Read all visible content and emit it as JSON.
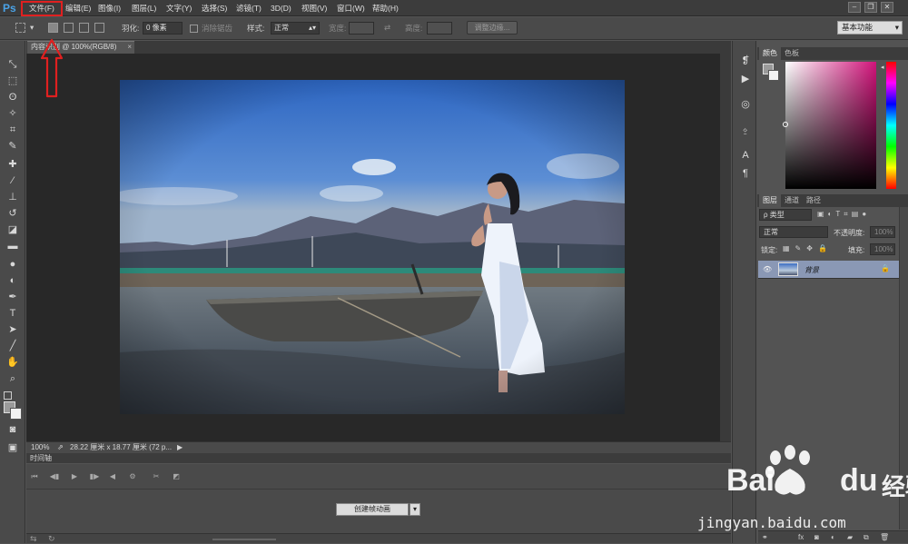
{
  "app": {
    "logo": "Ps"
  },
  "menu": {
    "items": [
      "文件(F)",
      "编辑(E)",
      "图像(I)",
      "图层(L)",
      "文字(Y)",
      "选择(S)",
      "滤镜(T)",
      "3D(D)",
      "视图(V)",
      "窗口(W)",
      "帮助(H)"
    ],
    "highlighted": "文件(F)"
  },
  "window_controls": {
    "minimize": "–",
    "restore": "❐",
    "close": "✕"
  },
  "options_bar": {
    "feather_label": "羽化:",
    "feather_value": "0 像素",
    "antialias_label": "消除锯齿",
    "style_label": "样式:",
    "style_value": "正常",
    "width_label": "宽度:",
    "height_label": "高度:",
    "refine_edge_button": "调整边缘...",
    "workspace": "基本功能"
  },
  "document": {
    "tab_title": "内容识别 @ 100%(RGB/8)",
    "tab_close": "×",
    "zoom": "100%",
    "doc_info": "28.22 厘米 x 18.77 厘米 (72 p..."
  },
  "timeline": {
    "tab_label": "时间轴",
    "create_button": "创建帧动画",
    "create_arrow": "▾"
  },
  "color_panel": {
    "tabs": [
      "颜色",
      "色板"
    ],
    "hue_color": "#d1137a"
  },
  "layers_panel": {
    "tabs": [
      "图层",
      "通道",
      "路径"
    ],
    "filter_type": "ρ 类型",
    "blend_mode": "正常",
    "opacity_label": "不透明度:",
    "opacity_value": "100%",
    "lock_label": "锁定:",
    "fill_label": "填充:",
    "fill_value": "100%",
    "layer_name": "背景"
  },
  "watermark": {
    "brand_left": "Bai",
    "brand_right": "du",
    "brand_cn": "经验",
    "url": "jingyan.baidu.com"
  },
  "colors": {
    "annotation_red": "#e02020",
    "selected_layer": "#8a98b5"
  }
}
